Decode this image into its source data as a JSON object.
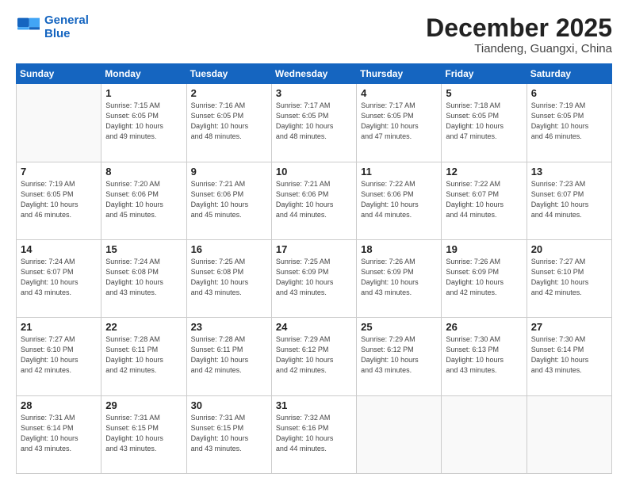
{
  "logo": {
    "line1": "General",
    "line2": "Blue"
  },
  "title": "December 2025",
  "location": "Tiandeng, Guangxi, China",
  "days_header": [
    "Sunday",
    "Monday",
    "Tuesday",
    "Wednesday",
    "Thursday",
    "Friday",
    "Saturday"
  ],
  "weeks": [
    [
      {
        "day": "",
        "sunrise": "",
        "sunset": "",
        "daylight": ""
      },
      {
        "day": "1",
        "sunrise": "Sunrise: 7:15 AM",
        "sunset": "Sunset: 6:05 PM",
        "daylight": "Daylight: 10 hours and 49 minutes."
      },
      {
        "day": "2",
        "sunrise": "Sunrise: 7:16 AM",
        "sunset": "Sunset: 6:05 PM",
        "daylight": "Daylight: 10 hours and 48 minutes."
      },
      {
        "day": "3",
        "sunrise": "Sunrise: 7:17 AM",
        "sunset": "Sunset: 6:05 PM",
        "daylight": "Daylight: 10 hours and 48 minutes."
      },
      {
        "day": "4",
        "sunrise": "Sunrise: 7:17 AM",
        "sunset": "Sunset: 6:05 PM",
        "daylight": "Daylight: 10 hours and 47 minutes."
      },
      {
        "day": "5",
        "sunrise": "Sunrise: 7:18 AM",
        "sunset": "Sunset: 6:05 PM",
        "daylight": "Daylight: 10 hours and 47 minutes."
      },
      {
        "day": "6",
        "sunrise": "Sunrise: 7:19 AM",
        "sunset": "Sunset: 6:05 PM",
        "daylight": "Daylight: 10 hours and 46 minutes."
      }
    ],
    [
      {
        "day": "7",
        "sunrise": "Sunrise: 7:19 AM",
        "sunset": "Sunset: 6:05 PM",
        "daylight": "Daylight: 10 hours and 46 minutes."
      },
      {
        "day": "8",
        "sunrise": "Sunrise: 7:20 AM",
        "sunset": "Sunset: 6:06 PM",
        "daylight": "Daylight: 10 hours and 45 minutes."
      },
      {
        "day": "9",
        "sunrise": "Sunrise: 7:21 AM",
        "sunset": "Sunset: 6:06 PM",
        "daylight": "Daylight: 10 hours and 45 minutes."
      },
      {
        "day": "10",
        "sunrise": "Sunrise: 7:21 AM",
        "sunset": "Sunset: 6:06 PM",
        "daylight": "Daylight: 10 hours and 44 minutes."
      },
      {
        "day": "11",
        "sunrise": "Sunrise: 7:22 AM",
        "sunset": "Sunset: 6:06 PM",
        "daylight": "Daylight: 10 hours and 44 minutes."
      },
      {
        "day": "12",
        "sunrise": "Sunrise: 7:22 AM",
        "sunset": "Sunset: 6:07 PM",
        "daylight": "Daylight: 10 hours and 44 minutes."
      },
      {
        "day": "13",
        "sunrise": "Sunrise: 7:23 AM",
        "sunset": "Sunset: 6:07 PM",
        "daylight": "Daylight: 10 hours and 44 minutes."
      }
    ],
    [
      {
        "day": "14",
        "sunrise": "Sunrise: 7:24 AM",
        "sunset": "Sunset: 6:07 PM",
        "daylight": "Daylight: 10 hours and 43 minutes."
      },
      {
        "day": "15",
        "sunrise": "Sunrise: 7:24 AM",
        "sunset": "Sunset: 6:08 PM",
        "daylight": "Daylight: 10 hours and 43 minutes."
      },
      {
        "day": "16",
        "sunrise": "Sunrise: 7:25 AM",
        "sunset": "Sunset: 6:08 PM",
        "daylight": "Daylight: 10 hours and 43 minutes."
      },
      {
        "day": "17",
        "sunrise": "Sunrise: 7:25 AM",
        "sunset": "Sunset: 6:09 PM",
        "daylight": "Daylight: 10 hours and 43 minutes."
      },
      {
        "day": "18",
        "sunrise": "Sunrise: 7:26 AM",
        "sunset": "Sunset: 6:09 PM",
        "daylight": "Daylight: 10 hours and 43 minutes."
      },
      {
        "day": "19",
        "sunrise": "Sunrise: 7:26 AM",
        "sunset": "Sunset: 6:09 PM",
        "daylight": "Daylight: 10 hours and 42 minutes."
      },
      {
        "day": "20",
        "sunrise": "Sunrise: 7:27 AM",
        "sunset": "Sunset: 6:10 PM",
        "daylight": "Daylight: 10 hours and 42 minutes."
      }
    ],
    [
      {
        "day": "21",
        "sunrise": "Sunrise: 7:27 AM",
        "sunset": "Sunset: 6:10 PM",
        "daylight": "Daylight: 10 hours and 42 minutes."
      },
      {
        "day": "22",
        "sunrise": "Sunrise: 7:28 AM",
        "sunset": "Sunset: 6:11 PM",
        "daylight": "Daylight: 10 hours and 42 minutes."
      },
      {
        "day": "23",
        "sunrise": "Sunrise: 7:28 AM",
        "sunset": "Sunset: 6:11 PM",
        "daylight": "Daylight: 10 hours and 42 minutes."
      },
      {
        "day": "24",
        "sunrise": "Sunrise: 7:29 AM",
        "sunset": "Sunset: 6:12 PM",
        "daylight": "Daylight: 10 hours and 42 minutes."
      },
      {
        "day": "25",
        "sunrise": "Sunrise: 7:29 AM",
        "sunset": "Sunset: 6:12 PM",
        "daylight": "Daylight: 10 hours and 43 minutes."
      },
      {
        "day": "26",
        "sunrise": "Sunrise: 7:30 AM",
        "sunset": "Sunset: 6:13 PM",
        "daylight": "Daylight: 10 hours and 43 minutes."
      },
      {
        "day": "27",
        "sunrise": "Sunrise: 7:30 AM",
        "sunset": "Sunset: 6:14 PM",
        "daylight": "Daylight: 10 hours and 43 minutes."
      }
    ],
    [
      {
        "day": "28",
        "sunrise": "Sunrise: 7:31 AM",
        "sunset": "Sunset: 6:14 PM",
        "daylight": "Daylight: 10 hours and 43 minutes."
      },
      {
        "day": "29",
        "sunrise": "Sunrise: 7:31 AM",
        "sunset": "Sunset: 6:15 PM",
        "daylight": "Daylight: 10 hours and 43 minutes."
      },
      {
        "day": "30",
        "sunrise": "Sunrise: 7:31 AM",
        "sunset": "Sunset: 6:15 PM",
        "daylight": "Daylight: 10 hours and 43 minutes."
      },
      {
        "day": "31",
        "sunrise": "Sunrise: 7:32 AM",
        "sunset": "Sunset: 6:16 PM",
        "daylight": "Daylight: 10 hours and 44 minutes."
      },
      {
        "day": "",
        "sunrise": "",
        "sunset": "",
        "daylight": ""
      },
      {
        "day": "",
        "sunrise": "",
        "sunset": "",
        "daylight": ""
      },
      {
        "day": "",
        "sunrise": "",
        "sunset": "",
        "daylight": ""
      }
    ]
  ]
}
